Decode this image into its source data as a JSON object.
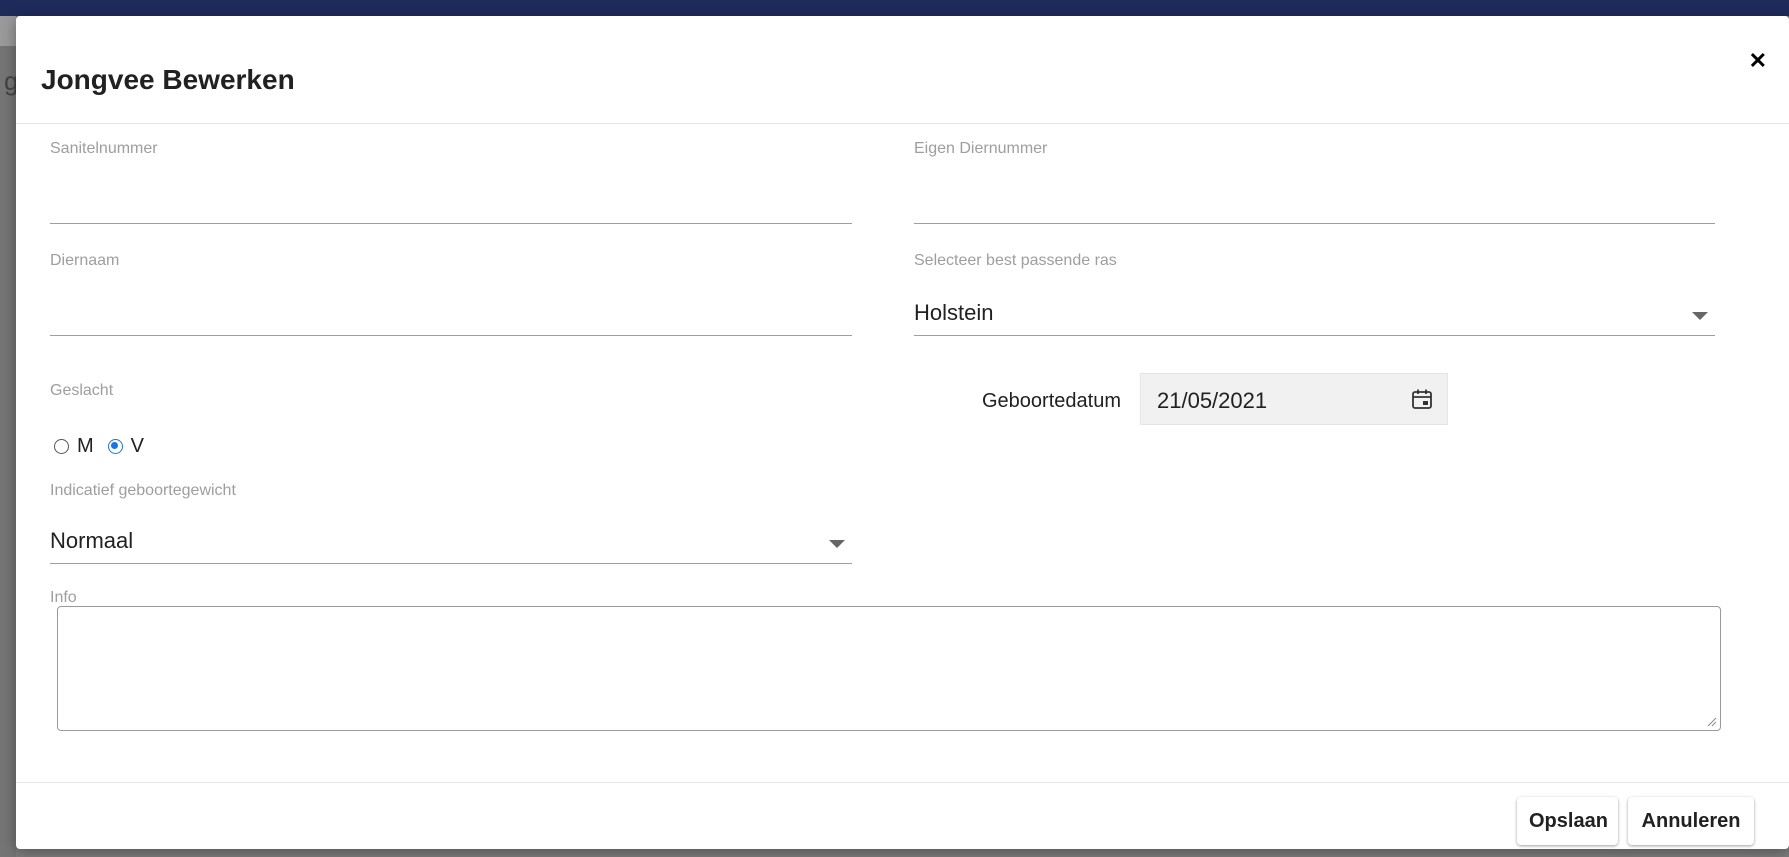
{
  "dialog": {
    "title": "Jongvee Bewerken",
    "close_glyph": "✕"
  },
  "backdrop": {
    "partial_text": "g"
  },
  "form": {
    "sanitelnummer": {
      "label": "Sanitelnummer",
      "value": ""
    },
    "eigen_diernummer": {
      "label": "Eigen Diernummer",
      "value": ""
    },
    "diernaam": {
      "label": "Diernaam",
      "value": ""
    },
    "ras": {
      "label": "Selecteer best passende ras",
      "value": "Holstein"
    },
    "geslacht": {
      "label": "Geslacht",
      "options": [
        {
          "label": "M",
          "checked": false
        },
        {
          "label": "V",
          "checked": true
        }
      ]
    },
    "geboortedatum": {
      "label": "Geboortedatum",
      "value": "21/05/2021"
    },
    "geboortegewicht": {
      "label": "Indicatief geboortegewicht",
      "value": "Normaal"
    },
    "info": {
      "label": "Info",
      "value": ""
    }
  },
  "footer": {
    "save_label": "Opslaan",
    "cancel_label": "Annuleren"
  },
  "colors": {
    "topbar": "#1e2a5a",
    "radio_accent": "#1a73e8",
    "label_gray": "#9e9e9e"
  },
  "icons": {
    "close": "close-icon",
    "calendar": "calendar-icon",
    "dropdown": "chevron-down-icon"
  }
}
